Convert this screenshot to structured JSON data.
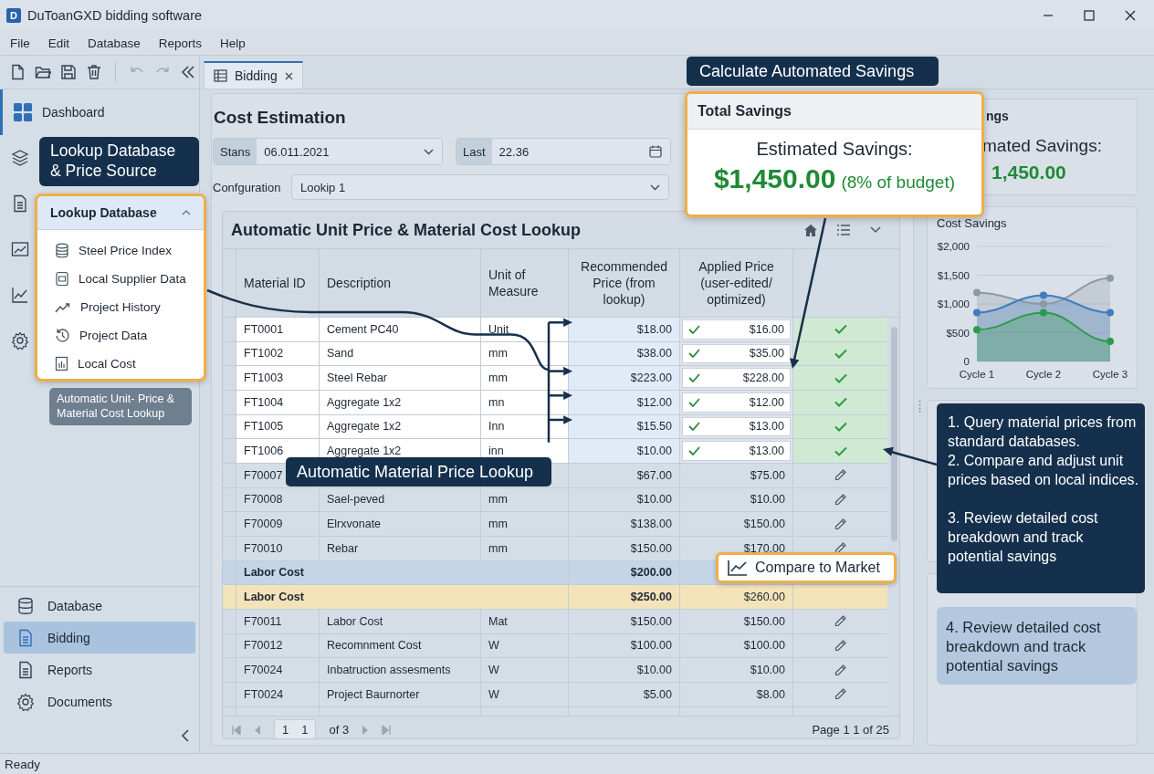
{
  "window": {
    "logo": "D",
    "title": "DuToanGXD bidding software"
  },
  "menu": [
    "File",
    "Edit",
    "Database",
    "Reports",
    "Help"
  ],
  "sidebar": {
    "dashboard": "Dashboard",
    "nav": [
      {
        "label": "Database",
        "selected": false
      },
      {
        "label": "Bidding",
        "selected": true
      },
      {
        "label": "Reports",
        "selected": false
      },
      {
        "label": "Documents",
        "selected": false
      }
    ]
  },
  "tabs": [
    {
      "label": "Bidding",
      "selected": true
    }
  ],
  "page": {
    "title": "Cost Estimation",
    "filters": [
      {
        "kind": "select",
        "label": "Stans",
        "value": "06.011.2021"
      },
      {
        "kind": "date",
        "label": "Last",
        "value": "22.36"
      }
    ],
    "configuration": {
      "label": "Confguration",
      "value": "Lookip 1"
    }
  },
  "table": {
    "title": "Automatic Unit Price & Material Cost Lookup",
    "columns": [
      "Material ID",
      "Description",
      "Unit of Measure",
      "Recommended Price (from lookup)",
      "Applied Price (user-edited/ optimized)"
    ],
    "rows": [
      {
        "kind": "matched",
        "id": "FT0001",
        "description": "Cement PC40",
        "unit": "Unit",
        "recommended": "$18.00",
        "applied": "$16.00"
      },
      {
        "kind": "matched",
        "id": "FT1002",
        "description": "Sand",
        "unit": "mm",
        "recommended": "$38.00",
        "applied": "$35.00"
      },
      {
        "kind": "matched",
        "id": "FT1003",
        "description": "Steel Rebar",
        "unit": "mm",
        "recommended": "$223.00",
        "applied": "$228.00"
      },
      {
        "kind": "matched",
        "id": "FT1004",
        "description": "Aggregate 1x2",
        "unit": "mn",
        "recommended": "$12.00",
        "applied": "$12.00"
      },
      {
        "kind": "matched",
        "id": "FT1005",
        "description": "Aggregate 1x2",
        "unit": "Inn",
        "recommended": "$15.50",
        "applied": "$13.00"
      },
      {
        "kind": "matched",
        "id": "FT1006",
        "description": "Aggregate 1x2",
        "unit": "inn",
        "recommended": "$10.00",
        "applied": "$13.00"
      },
      {
        "kind": "manual",
        "id": "F70007",
        "recommended": "$67.00",
        "applied": "$75.00"
      },
      {
        "kind": "manual",
        "id": "F70008",
        "description": "Sael-peved",
        "unit": "mm",
        "recommended": "$10.00",
        "applied": "$10.00"
      },
      {
        "kind": "manual",
        "id": "F70009",
        "description": "Elrxvonate",
        "unit": "mm",
        "recommended": "$138.00",
        "applied": "$150.00"
      },
      {
        "kind": "manual",
        "id": "F70010",
        "description": "Rebar",
        "unit": "mm",
        "recommended": "$150.00",
        "applied": "$170.00"
      },
      {
        "kind": "subtotal",
        "label": "Labor Cost",
        "recommended": "$200.00",
        "highlighted": false
      },
      {
        "kind": "subtotal",
        "label": "Labor Cost",
        "recommended": "$250.00",
        "applied": "$260.00",
        "highlighted": true
      },
      {
        "kind": "manual",
        "id": "F70011",
        "description": "Labor Cost",
        "unit": "Mat",
        "recommended": "$150.00",
        "applied": "$150.00"
      },
      {
        "kind": "manual",
        "id": "F70012",
        "description": "Recomnment Cost",
        "unit": "W",
        "recommended": "$100.00",
        "applied": "$100.00"
      },
      {
        "kind": "manual",
        "id": "F70024",
        "description": "Inbatruction assesments",
        "unit": "W",
        "recommended": "$10.00",
        "applied": "$10.00"
      },
      {
        "kind": "manual",
        "id": "FT0024",
        "description": "Project Baurnorter",
        "unit": "W",
        "recommended": "$5.00",
        "applied": "$8.00"
      }
    ],
    "pagination": {
      "page_box": [
        "1",
        "1"
      ],
      "of": "of 3",
      "summary": "Page 1 1 of 25"
    }
  },
  "right_panel": {
    "savings_card": {
      "title": "ngs",
      "label": "mated Savings:",
      "amount": "1,450.00"
    },
    "chart_card": {
      "title": "Cost Savings",
      "chart_data": {
        "type": "area",
        "grid": true,
        "categories": [
          "Cycle 1",
          "Cycle 2",
          "Cycle 3"
        ],
        "ylim": [
          0,
          2000
        ],
        "yticks": [
          {
            "value": 0,
            "label": "0"
          },
          {
            "value": 500,
            "label": "$500"
          },
          {
            "value": 1000,
            "label": "$1,000"
          },
          {
            "value": 1500,
            "label": "$1,500"
          },
          {
            "value": 2000,
            "label": "$2,000"
          }
        ],
        "series": [
          {
            "color": "#8e99a6",
            "values": [
              1200,
              1000,
              1450
            ]
          },
          {
            "color": "#3f7cc0",
            "values": [
              850,
              1150,
              850
            ]
          },
          {
            "color": "#2f9a4a",
            "values": [
              550,
              850,
              350
            ]
          }
        ]
      }
    },
    "note": "4. Review detailed cost breakdown and track potential savings"
  },
  "lookup_panel": {
    "title": "Lookup Database",
    "expanded": true,
    "items": [
      "Steel Price Index",
      "Local Supplier Data",
      "Project History",
      "Project Data",
      "Local Cost"
    ]
  },
  "callouts": {
    "database": "Lookup Database & Price Source",
    "lookup_label": "Automatic Unit- Price & Material Cost Lookup",
    "material_lookup": "Automatic Material Price Lookup",
    "savings": "Calculate Automated Savings",
    "steps": [
      "1. Query material prices from standard databases.",
      "2. Compare and adjust unit prices based on local indices.",
      "3. Review detailed cost breakdown and track potential savings"
    ]
  },
  "total_savings": {
    "title": "Total Savings",
    "label": "Estimated Savings:",
    "amount": "$1,450.00",
    "note": "(8% of budget)"
  },
  "compare_button": "Compare to Market",
  "status_bar": "Ready"
}
